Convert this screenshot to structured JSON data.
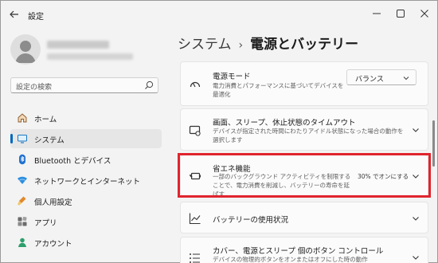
{
  "window": {
    "title": "設定"
  },
  "sidebar": {
    "search_placeholder": "設定の検索",
    "items": [
      {
        "label": "ホーム",
        "icon": "home-icon"
      },
      {
        "label": "システム",
        "icon": "system-icon",
        "active": true
      },
      {
        "label": "Bluetooth とデバイス",
        "icon": "bluetooth-icon"
      },
      {
        "label": "ネットワークとインターネット",
        "icon": "network-icon"
      },
      {
        "label": "個人用設定",
        "icon": "personalization-icon"
      },
      {
        "label": "アプリ",
        "icon": "apps-icon"
      },
      {
        "label": "アカウント",
        "icon": "account-icon"
      }
    ]
  },
  "breadcrumb": {
    "parent": "システム",
    "separator": "›",
    "current": "電源とバッテリー"
  },
  "cards": {
    "power_mode": {
      "title": "電源モード",
      "desc": "電力消費とパフォーマンスに基づいてデバイスを最適化",
      "value": "バランス"
    },
    "screen_sleep": {
      "title": "画面、スリープ、休止状態のタイムアウト",
      "desc": "デバイスが指定された時間にわたりアイドル状態になった場合の動作を選択します"
    },
    "energy_saver": {
      "title": "省エネ機能",
      "desc": "一部のバックグラウンド アクティビティを制限することで、電力消費を削減し、バッテリーの寿命を延ばす",
      "status": "30% でオンにする"
    },
    "battery_usage": {
      "title": "バッテリーの使用状況"
    },
    "lid_button": {
      "title": "カバー、電源とスリープ 個のボタン コントロール",
      "desc": "デバイスの物理的ボタンをオンまたはオフにした時の動作"
    }
  },
  "colors": {
    "accent": "#0067c0",
    "highlight": "#e0242e"
  }
}
